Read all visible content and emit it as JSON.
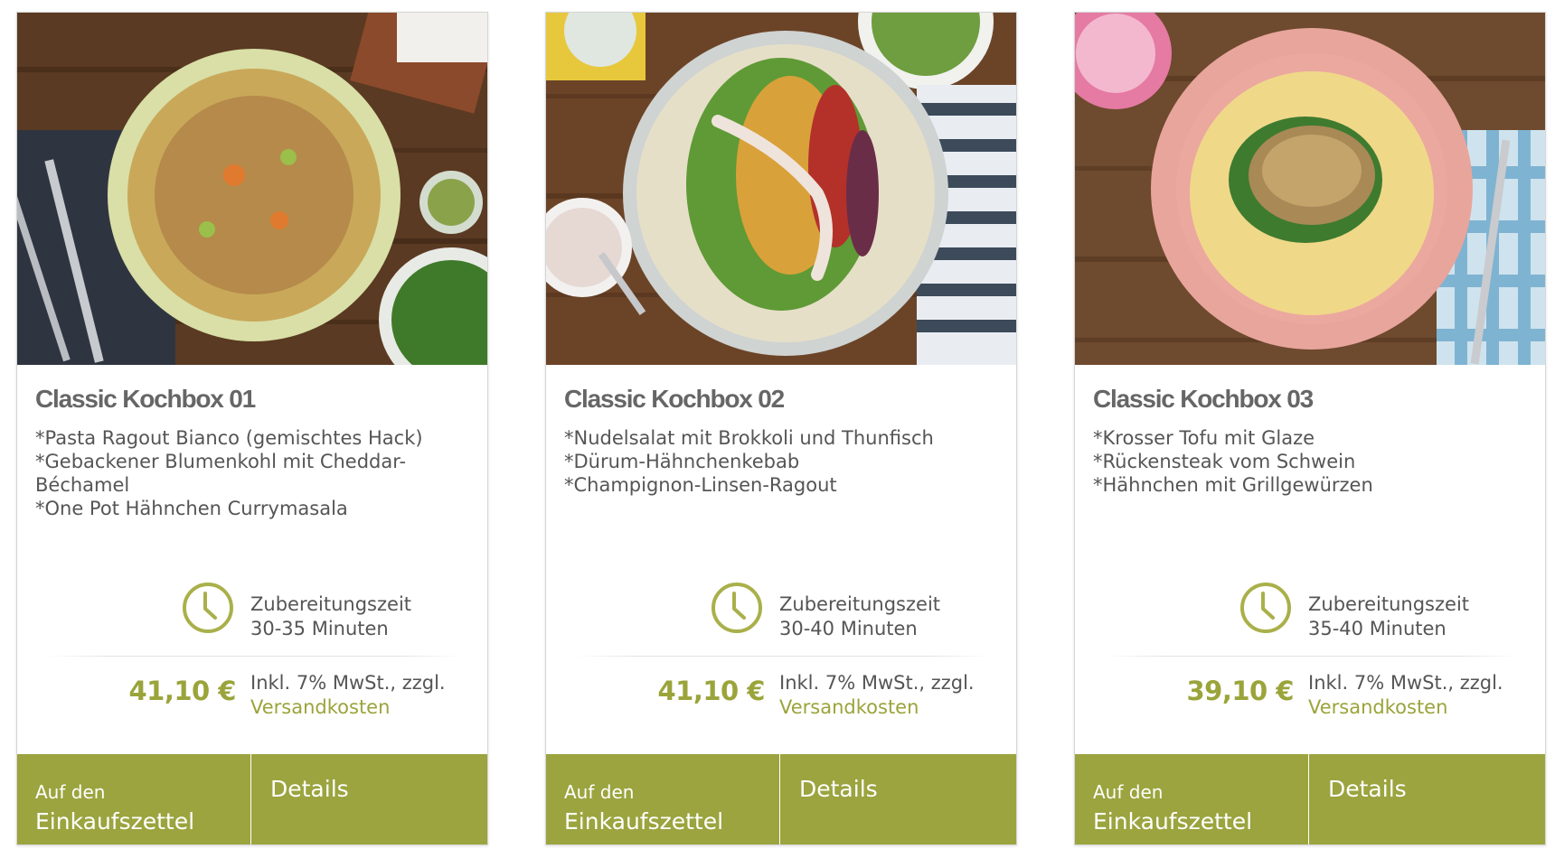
{
  "theme": {
    "accent": "#9ba43e",
    "price_color": "#9aa43a",
    "text": "#555555",
    "title": "#666666"
  },
  "products": [
    {
      "image_icon": "pasta-ragout-photo",
      "title": "Classic Kochbox 01",
      "dishes": [
        "*Pasta Ragout Bianco (gemischtes Hack)",
        "*Gebackener Blumenkohl mit Cheddar-Béchamel",
        "*One Pot Hähnchen Currymasala"
      ],
      "prep_label": "Zubereitungszeit",
      "prep_time": "30-35 Minuten",
      "price": "41,10 €",
      "tax_text": "Inkl. 7% MwSt., zzgl.",
      "shipping_link": "Versandkosten",
      "cart_small": "Auf den",
      "cart_big": "Einkaufszettel",
      "details": "Details"
    },
    {
      "image_icon": "chicken-wrap-photo",
      "title": "Classic Kochbox 02",
      "dishes": [
        "*Nudelsalat mit Brokkoli und Thunfisch",
        "*Dürum-Hähnchenkebab",
        "*Champignon-Linsen-Ragout"
      ],
      "prep_label": "Zubereitungszeit",
      "prep_time": "30-40 Minuten",
      "price": "41,10 €",
      "tax_text": "Inkl. 7% MwSt., zzgl.",
      "shipping_link": "Versandkosten",
      "cart_small": "Auf den",
      "cart_big": "Einkaufszettel",
      "details": "Details"
    },
    {
      "image_icon": "tofu-rigatoni-photo",
      "title": "Classic Kochbox 03",
      "dishes": [
        "*Krosser Tofu mit Glaze",
        "*Rückensteak vom Schwein",
        "*Hähnchen mit Grillgewürzen"
      ],
      "prep_label": "Zubereitungszeit",
      "prep_time": "35-40 Minuten",
      "price": "39,10 €",
      "tax_text": "Inkl. 7% MwSt., zzgl.",
      "shipping_link": "Versandkosten",
      "cart_small": "Auf den",
      "cart_big": "Einkaufszettel",
      "details": "Details"
    }
  ]
}
